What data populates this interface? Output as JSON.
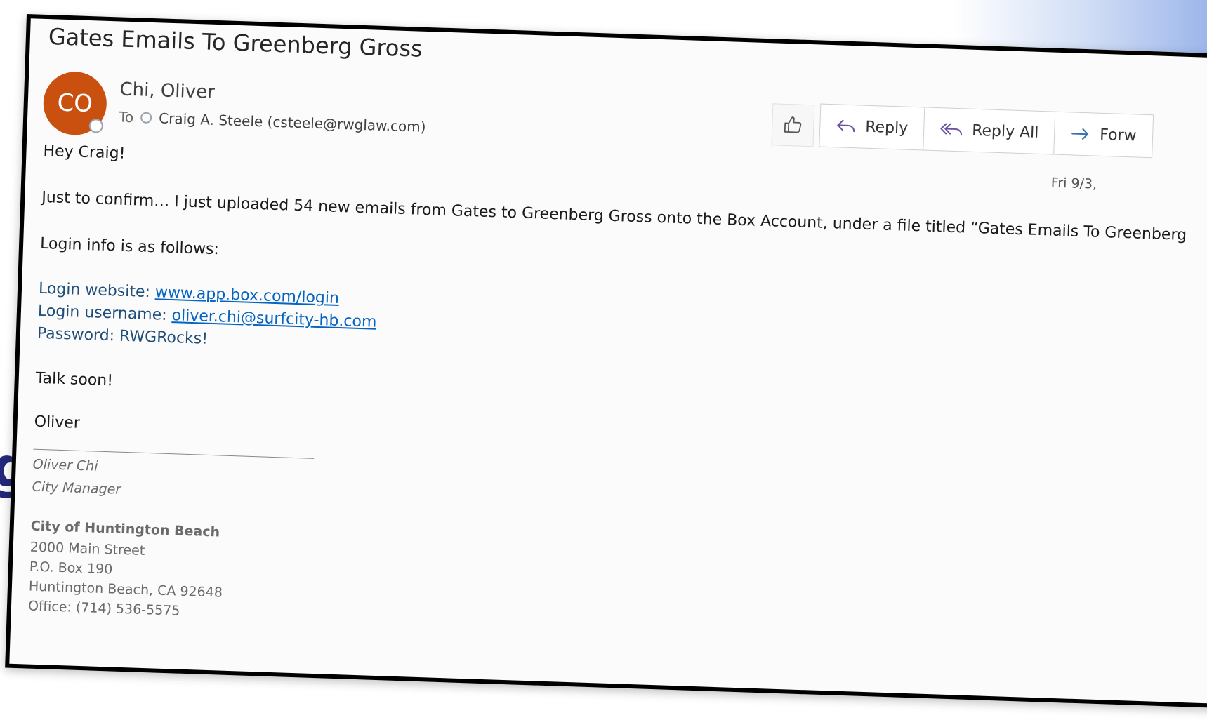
{
  "email": {
    "subject": "Gates Emails To Greenberg Gross",
    "sender": {
      "name": "Chi, Oliver",
      "initials": "CO",
      "avatar_color": "#ca5010"
    },
    "to_label": "To",
    "recipient": "Craig A. Steele (csteele@rwglaw.com)",
    "date": "Fri 9/3,"
  },
  "toolbar": {
    "like_icon": "thumbs-up-icon",
    "reply_label": "Reply",
    "reply_all_label": "Reply All",
    "forward_label": "Forw"
  },
  "body": {
    "greeting": "Hey Craig!",
    "paragraph1": "Just to confirm… I just uploaded 54 new emails from Gates to Greenberg Gross onto the Box Account, under a file titled “Gates Emails To Greenberg",
    "paragraph2": "Login info is as follows:",
    "login_website_label": "Login website: ",
    "login_website": "www.app.box.com/login",
    "login_username_label": "Login username: ",
    "login_username": "oliver.chi@surfcity-hb.com",
    "password_line": "Password: RWGRocks!",
    "closing": "Talk soon!",
    "sign_name": "Oliver"
  },
  "signature": {
    "name": "Oliver Chi",
    "title": "City Manager",
    "organization": "City of Huntington Beach",
    "street": "2000 Main Street",
    "po_box": "P.O. Box 190",
    "city": "Huntington Beach, CA 92648",
    "office": "Office: (714) 536-5575"
  },
  "background": {
    "edge_glyph": "g"
  }
}
